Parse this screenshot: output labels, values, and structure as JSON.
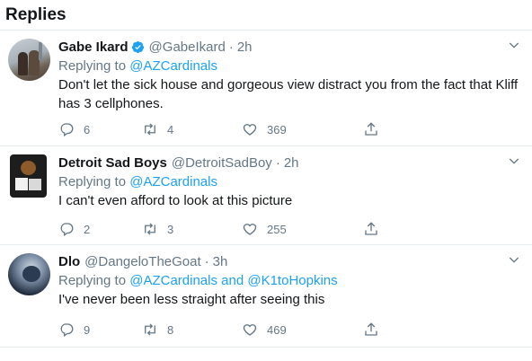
{
  "header": {
    "title": "Replies"
  },
  "replies": [
    {
      "name": "Gabe Ikard",
      "verified": true,
      "handle": "@GabeIkard",
      "time": "2h",
      "replying_prefix": "Replying to ",
      "mentions": [
        "@AZCardinals"
      ],
      "mention_joiner": "",
      "text": "Don't let the sick house and gorgeous view distract you from the fact that Kliff has 3 cellphones.",
      "reply_count": "6",
      "retweet_count": "4",
      "like_count": "369"
    },
    {
      "name": "Detroit Sad Boys",
      "verified": false,
      "handle": "@DetroitSadBoy",
      "time": "2h",
      "replying_prefix": "Replying to ",
      "mentions": [
        "@AZCardinals"
      ],
      "mention_joiner": "",
      "text": "I can't even afford to look at this picture",
      "reply_count": "2",
      "retweet_count": "3",
      "like_count": "255"
    },
    {
      "name": "Dlo",
      "verified": false,
      "handle": "@DangeloTheGoat",
      "time": "3h",
      "replying_prefix": "Replying to ",
      "mentions": [
        "@AZCardinals",
        "@K1toHopkins"
      ],
      "mention_joiner": " and ",
      "text": "I've never been less straight after seeing this",
      "reply_count": "9",
      "retweet_count": "8",
      "like_count": "469"
    }
  ],
  "icons": {
    "reply": "reply-icon",
    "retweet": "retweet-icon",
    "like": "heart-icon",
    "share": "share-icon",
    "more": "chevron-down-icon",
    "verified": "verified-badge-icon"
  },
  "colors": {
    "accent": "#1da1f2",
    "secondary_text": "#657786",
    "primary_text": "#14171a",
    "divider": "#e6ecf0"
  }
}
